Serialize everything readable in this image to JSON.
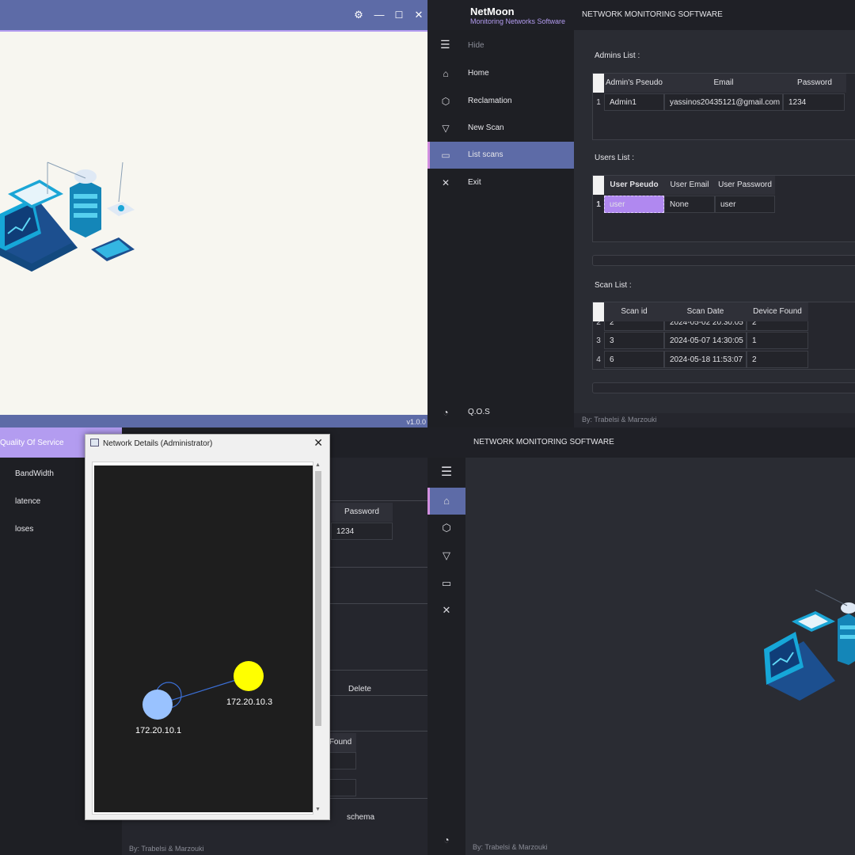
{
  "q1": {
    "version": "v1.0.0",
    "icons": [
      "gear-icon",
      "minimize-icon",
      "maximize-icon",
      "close-icon"
    ]
  },
  "app": {
    "name": "NetMoon",
    "subtitle": "Monitoring Networks Software",
    "header": "NETWORK MONITORING SOFTWARE",
    "footer": "By: Trabelsi & Marzouki"
  },
  "sidebar": {
    "hide_label": "Hide",
    "items": [
      {
        "label": "Home",
        "icon": "home-icon"
      },
      {
        "label": "Reclamation",
        "icon": "box-icon"
      },
      {
        "label": "New Scan",
        "icon": "wifi-icon"
      },
      {
        "label": "List scans",
        "icon": "laptop-icon"
      },
      {
        "label": "Exit",
        "icon": "close-icon"
      }
    ],
    "qos_label": "Q.O.S"
  },
  "admins": {
    "title": "Admins List :",
    "columns": [
      "Admin's Pseudo",
      "Email",
      "Password"
    ],
    "rows": [
      {
        "num": "1",
        "pseudo": "Admin1",
        "email": "yassinos20435121@gmail.com",
        "password": "1234"
      }
    ]
  },
  "users": {
    "title": "Users List :",
    "columns": [
      "User Pseudo",
      "User Email",
      "User Password"
    ],
    "rows": [
      {
        "num": "1",
        "pseudo": "user",
        "email": "None",
        "password": "user"
      }
    ]
  },
  "scans": {
    "title": "Scan List :",
    "columns": [
      "Scan id",
      "Scan Date",
      "Device Found"
    ],
    "rows": [
      {
        "num": "2",
        "id": "2",
        "date": "2024-05-02 20:30:05",
        "found": "2"
      },
      {
        "num": "3",
        "id": "3",
        "date": "2024-05-07 14:30:05",
        "found": "1"
      },
      {
        "num": "4",
        "id": "6",
        "date": "2024-05-18 11:53:07",
        "found": "2"
      }
    ]
  },
  "qos": {
    "title": "Quality Of Service",
    "items": [
      "BandWidth",
      "latence",
      "loses"
    ],
    "partial": {
      "password_header": "Password",
      "password_value": "1234",
      "delete_label": "Delete",
      "found_label": "Found",
      "schema_label": "schema"
    }
  },
  "dialog": {
    "title": "Network Details (Administrator)",
    "nodes": [
      {
        "label": "172.20.10.1",
        "color": "#99c2ff"
      },
      {
        "label": "172.20.10.3",
        "color": "#ffff00"
      }
    ]
  },
  "colors": {
    "accent": "#5d6ba7",
    "highlight": "#b39cf0",
    "active_marker": "#d28fe0",
    "selected_cell": "#b088f0"
  }
}
